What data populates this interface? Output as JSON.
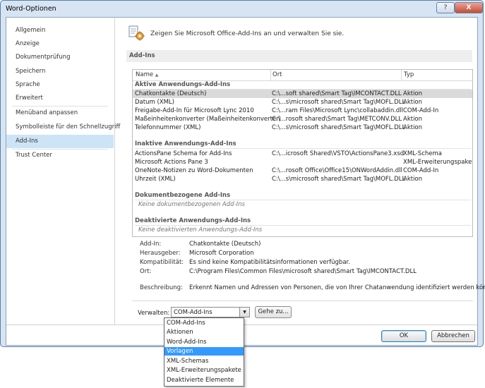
{
  "window": {
    "title": "Word-Optionen",
    "help_label": "?",
    "close_label": "X"
  },
  "sidebar": {
    "items": [
      {
        "label": "Allgemein"
      },
      {
        "label": "Anzeige"
      },
      {
        "label": "Dokumentprüfung"
      },
      {
        "label": "Speichern"
      },
      {
        "label": "Sprache"
      },
      {
        "label": "Erweitert"
      },
      {
        "label": "Menüband anpassen"
      },
      {
        "label": "Symbolleiste für den Schnellzugriff"
      },
      {
        "label": "Add-Ins"
      },
      {
        "label": "Trust Center"
      }
    ],
    "active": "Add-Ins"
  },
  "header": {
    "icon": "addins-gear-icon",
    "text": "Zeigen Sie Microsoft Office-Add-Ins an und verwalten Sie sie."
  },
  "section": {
    "title": "Add-Ins"
  },
  "table": {
    "columns": [
      "Name",
      "Ort",
      "Typ"
    ],
    "sort_indicator": "▲",
    "groups": [
      {
        "title": "Aktive Anwendungs-Add-Ins",
        "rows": [
          {
            "name": "Chatkontakte (Deutsch)",
            "location": "C:\\...soft shared\\Smart Tag\\IMCONTACT.DLL",
            "type": "Aktion"
          },
          {
            "name": "Datum (XML)",
            "location": "C:\\...s\\microsoft shared\\Smart Tag\\MOFL.DLL",
            "type": "Aktion"
          },
          {
            "name": "Freigabe-Add-In für Microsoft Lync 2010",
            "location": "C:\\...ram Files\\Microsoft Lync\\collabaddin.dll",
            "type": "COM-Add-In"
          },
          {
            "name": "Maßeinheitenkonverter (Maßeinheitenkonverter)",
            "location": "C:\\...rosoft shared\\Smart Tag\\METCONV.DLL",
            "type": "Aktion"
          },
          {
            "name": "Telefonnummer (XML)",
            "location": "C:\\...s\\microsoft shared\\Smart Tag\\MOFL.DLL",
            "type": "Aktion"
          }
        ]
      },
      {
        "title": "Inaktive Anwendungs-Add-Ins",
        "rows": [
          {
            "name": "ActionsPane Schema for Add-Ins",
            "location": "C:\\...icrosoft Shared\\VSTO\\ActionsPane3.xsd",
            "type": "XML-Schema"
          },
          {
            "name": "Microsoft Actions Pane 3",
            "location": "",
            "type": "XML-Erweiterungspaket"
          },
          {
            "name": "OneNote-Notizen zu Word-Dokumenten",
            "location": "C:\\...rosoft Office\\Office15\\ONWordAddin.dll",
            "type": "COM-Add-In"
          },
          {
            "name": "Uhrzeit (XML)",
            "location": "C:\\...s\\microsoft shared\\Smart Tag\\MOFL.DLL",
            "type": "Aktion"
          }
        ]
      },
      {
        "title": "Dokumentbezogene Add-Ins",
        "empty_text": "Keine dokumentbezogenen Add-Ins"
      },
      {
        "title": "Deaktivierte Anwendungs-Add-Ins",
        "empty_text": "Keine deaktivierten Anwendungs-Add-Ins"
      }
    ],
    "selected_row": "Chatkontakte (Deutsch)"
  },
  "details": {
    "addin_label": "Add-In:",
    "addin_value": "Chatkontakte (Deutsch)",
    "publisher_label": "Herausgeber:",
    "publisher_value": "Microsoft Corporation",
    "compat_label": "Kompatibilität:",
    "compat_value": "Es sind keine Kompatibilitätsinformationen verfügbar.",
    "location_label": "Ort:",
    "location_value": "C:\\Program Files\\Common Files\\microsoft shared\\Smart Tag\\IMCONTACT.DLL",
    "description_label": "Beschreibung:",
    "description_value": "Erkennt Namen und Adressen von Personen, die von Ihrer Chatanwendung identifiziert werden können."
  },
  "manage": {
    "label": "Verwalten:",
    "selected": "COM-Add-Ins",
    "go_label": "Gehe zu...",
    "options": [
      "COM-Add-Ins",
      "Aktionen",
      "Word-Add-Ins",
      "Vorlagen",
      "XML-Schemas",
      "XML-Erweiterungspakete",
      "Deaktivierte Elemente"
    ],
    "highlighted": "Vorlagen"
  },
  "buttons": {
    "ok": "OK",
    "cancel": "Abbrechen"
  },
  "colors": {
    "accent": "#3399ff",
    "sidebar_active": "#cde4f7",
    "window_frame": "#d6e4f3"
  }
}
